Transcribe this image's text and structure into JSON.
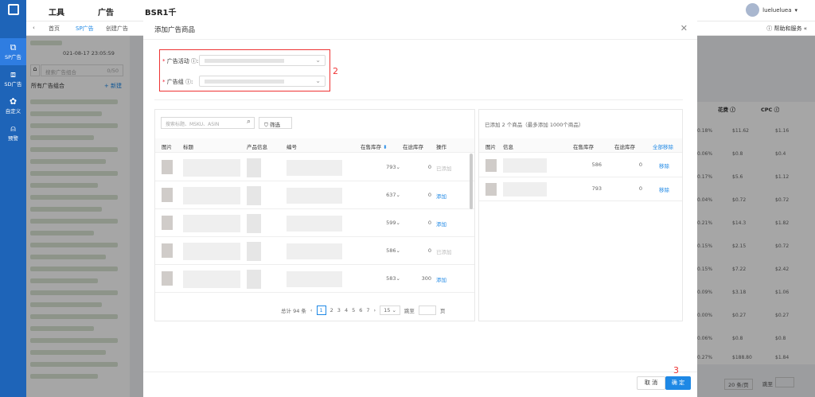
{
  "rail": {
    "items": [
      {
        "label": "SP广告",
        "icon": "sp-icon"
      },
      {
        "label": "SD广告",
        "icon": "sd-icon"
      },
      {
        "label": "自定义",
        "icon": "custom-icon"
      },
      {
        "label": "预警",
        "icon": "alert-icon"
      }
    ]
  },
  "topnav": {
    "tabs": [
      "工具",
      "广告",
      "BSR1千"
    ],
    "user": "luelueluea"
  },
  "subnav": {
    "home": "首页",
    "sp": "SP广告",
    "create": "创建广告",
    "help": "帮助和服务"
  },
  "leftpanel": {
    "time": "021-08-17 23:05:59",
    "search_placeholder": "搜索广告组合",
    "search_count": "0/50",
    "all_groups": "所有广告组合",
    "new_group": "+ 新建"
  },
  "bgtable": {
    "headers": [
      "花费 ⓘ",
      "CPC ⓘ"
    ],
    "rows": [
      [
        "0.18%",
        "$11.62",
        "$1.16"
      ],
      [
        "0.06%",
        "$0.8",
        "$0.4"
      ],
      [
        "0.17%",
        "$5.6",
        "$1.12"
      ],
      [
        "0.04%",
        "$0.72",
        "$0.72"
      ],
      [
        "0.21%",
        "$14.3",
        "$1.82"
      ],
      [
        "0.15%",
        "$2.15",
        "$0.72"
      ],
      [
        "0.15%",
        "$7.22",
        "$2.42"
      ],
      [
        "0.09%",
        "$3.18",
        "$1.06"
      ],
      [
        "0.00%",
        "$0.27",
        "$0.27"
      ],
      [
        "0.06%",
        "$0.8",
        "$0.8"
      ],
      [
        "0.27%",
        "$188.80",
        "$1.84"
      ]
    ],
    "page_size": "20 条/页",
    "jump": "跳至"
  },
  "modal": {
    "title": "添加广告商品",
    "campaign_label": "广告活动",
    "group_label": "广告组",
    "annotation_2": "2",
    "annotation_3": "3",
    "search_placeholder": "搜索标题、MSKU、ASIN",
    "filter_label": "筛选",
    "columns": [
      "图片",
      "标题",
      "产品信息",
      "编号",
      "在售库存",
      "在途库存",
      "操作"
    ],
    "products": [
      {
        "stock": "793",
        "transit": "0",
        "action": "已添加"
      },
      {
        "stock": "637",
        "transit": "0",
        "action": "添加"
      },
      {
        "stock": "599",
        "transit": "0",
        "action": "添加"
      },
      {
        "stock": "586",
        "transit": "0",
        "action": "已添加"
      },
      {
        "stock": "583",
        "transit": "300",
        "action": "添加"
      }
    ],
    "pager": {
      "total": "总计 94 条",
      "pages": [
        "1",
        "2",
        "3",
        "4",
        "5",
        "6",
        "7"
      ],
      "page_size": "15",
      "jump": "跳至",
      "page_suffix": "页"
    },
    "selected": {
      "caption": "已添加 2 个商品（最多添加 1000个商品）",
      "columns": [
        "图片",
        "信息",
        "在售库存",
        "在途库存",
        "全部移除"
      ],
      "rows": [
        {
          "stock": "586",
          "transit": "0",
          "action": "移除"
        },
        {
          "stock": "793",
          "transit": "0",
          "action": "移除"
        }
      ]
    },
    "cancel": "取 消",
    "confirm": "确 定"
  }
}
